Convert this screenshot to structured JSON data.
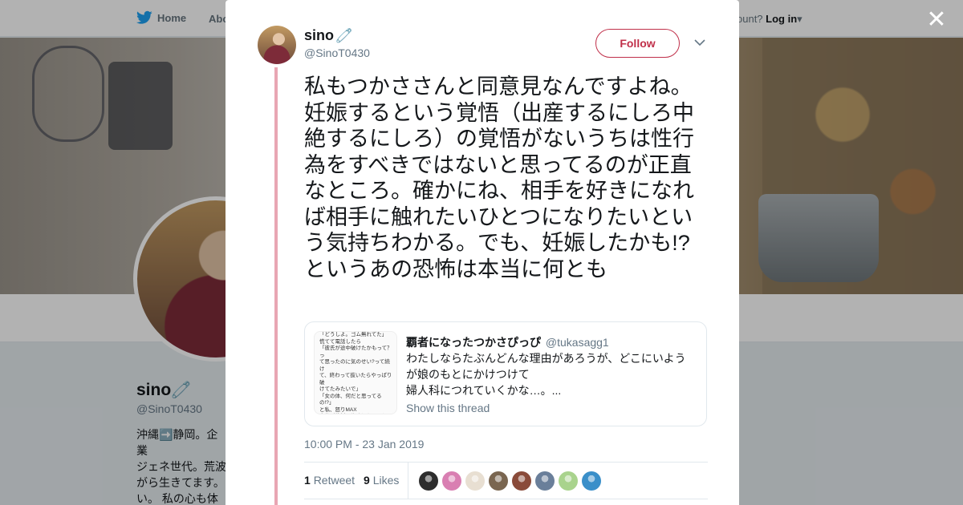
{
  "nav": {
    "home_label": "Home",
    "about_label": "Abo",
    "account_prompt": "ccount?",
    "login_label": "Log in"
  },
  "profile": {
    "name": "sino",
    "handle": "@SinoT0430",
    "bio": "沖縄➡️静岡。企業\nジェネ世代。荒波\nがら生きてます。\nい。 私の心も体も\nす（無断転載禁止"
  },
  "tweet": {
    "author_name": "sino",
    "author_handle": "@SinoT0430",
    "follow_label": "Follow",
    "text": "私もつかささんと同意見なんですよね。妊娠するという覚悟（出産するにしろ中絶するにしろ）の覚悟がないうちは性行為をすべきではないと思ってるのが正直なところ。確かにね、相手を好きになれば相手に触れたいひとつになりたいという気持ちわかる。でも、妊娠したかも!?というあの恐怖は本当に何とも",
    "timestamp": "10:00 PM - 23 Jan 2019",
    "retweet_count": "1",
    "retweet_label": "Retweet",
    "like_count": "9",
    "like_label": "Likes"
  },
  "quote": {
    "name": "覇者になったつかさぴっぴ",
    "handle": "@tukasagg1",
    "text": "わたしならたぶんどんな理由があろうが、どこにいようが娘のもとにかけつけて\n婦人科につれていくかな…。...",
    "show_thread_label": "Show this thread",
    "thumbnail_text": "「どうしよ。ゴム無れてた」\n慌てて電話したら\n「彼氏が途中破けたかもって？っ\nて思ったのに気のせい?って続け\nて、終わって抜いたらやっぱり破\nけてたみたいで」\n「女の体、何だと思ってるの!?」\nと私、怒りMAX\n自分が絶対に失敗したフリしてす\nぐにアフターピルを処方してもら"
  },
  "likers": [
    {
      "icon": "liker-avatar-1",
      "color": "#2d2d2d"
    },
    {
      "icon": "liker-avatar-2",
      "color": "#d97fb2"
    },
    {
      "icon": "liker-avatar-3",
      "color": "#e8dfd2"
    },
    {
      "icon": "liker-avatar-4",
      "color": "#7a6650"
    },
    {
      "icon": "liker-avatar-5",
      "color": "#8a4b3a"
    },
    {
      "icon": "liker-avatar-6",
      "color": "#6a7f9a"
    },
    {
      "icon": "liker-avatar-7",
      "color": "#a9d38d"
    },
    {
      "icon": "liker-avatar-8",
      "color": "#3a8fc9"
    }
  ],
  "colors": {
    "accent": "#c0304a",
    "thread_line": "#e8a6b3",
    "twitter_blue": "#1da1f2",
    "muted_text": "#657786"
  }
}
